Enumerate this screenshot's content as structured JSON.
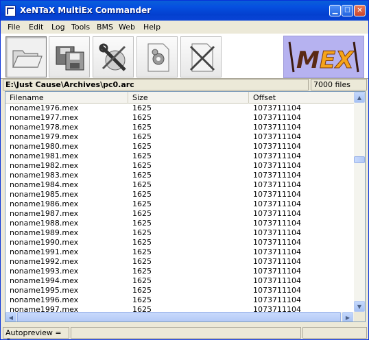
{
  "window": {
    "title": "XeNTaX MultiEx Commander"
  },
  "menu": [
    "File",
    "Edit",
    "Log",
    "Tools",
    "BMS",
    "Web",
    "Help"
  ],
  "toolbar": {
    "buttons": [
      "open-folder-icon",
      "save-archive-icon",
      "tools-settings-icon",
      "script-gear-icon",
      "close-archive-icon"
    ],
    "logo_text": "\\MEX\\"
  },
  "pathbar": {
    "path": "E:\\Just Cause\\Archives\\pc0.arc",
    "file_count": "7000 files"
  },
  "list": {
    "columns": [
      "Filename",
      "Size",
      "Offset"
    ],
    "rows": [
      [
        "noname1976.mex",
        "1625",
        "1073711104"
      ],
      [
        "noname1977.mex",
        "1625",
        "1073711104"
      ],
      [
        "noname1978.mex",
        "1625",
        "1073711104"
      ],
      [
        "noname1979.mex",
        "1625",
        "1073711104"
      ],
      [
        "noname1980.mex",
        "1625",
        "1073711104"
      ],
      [
        "noname1981.mex",
        "1625",
        "1073711104"
      ],
      [
        "noname1982.mex",
        "1625",
        "1073711104"
      ],
      [
        "noname1983.mex",
        "1625",
        "1073711104"
      ],
      [
        "noname1984.mex",
        "1625",
        "1073711104"
      ],
      [
        "noname1985.mex",
        "1625",
        "1073711104"
      ],
      [
        "noname1986.mex",
        "1625",
        "1073711104"
      ],
      [
        "noname1987.mex",
        "1625",
        "1073711104"
      ],
      [
        "noname1988.mex",
        "1625",
        "1073711104"
      ],
      [
        "noname1989.mex",
        "1625",
        "1073711104"
      ],
      [
        "noname1990.mex",
        "1625",
        "1073711104"
      ],
      [
        "noname1991.mex",
        "1625",
        "1073711104"
      ],
      [
        "noname1992.mex",
        "1625",
        "1073711104"
      ],
      [
        "noname1993.mex",
        "1625",
        "1073711104"
      ],
      [
        "noname1994.mex",
        "1625",
        "1073711104"
      ],
      [
        "noname1995.mex",
        "1625",
        "1073711104"
      ],
      [
        "noname1996.mex",
        "1625",
        "1073711104"
      ],
      [
        "noname1997.mex",
        "1625",
        "1073711104"
      ]
    ]
  },
  "status": {
    "autopreview": "Autopreview = On",
    "message": "",
    "extra": ""
  }
}
